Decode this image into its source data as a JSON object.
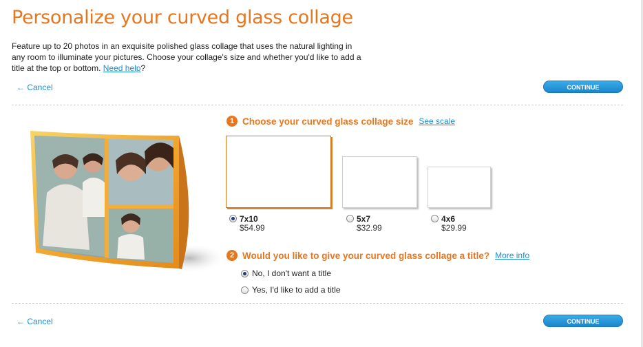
{
  "header": {
    "title": "Personalize your curved glass collage",
    "intro_text": "Feature up to 20 photos in an exquisite polished glass collage that uses the natural lighting in any room to illuminate your pictures. Choose your collage's size and whether you'd like to add a title at the top or bottom. ",
    "help_link": "Need help",
    "help_suffix": "?"
  },
  "nav": {
    "cancel_label": "← Cancel",
    "continue_label": "CONTINUE"
  },
  "step1": {
    "number": "1",
    "heading": "Choose your curved glass collage size",
    "link": "See scale",
    "options": [
      {
        "label": "7x10",
        "price": "$54.99",
        "selected": true
      },
      {
        "label": "5x7",
        "price": "$32.99",
        "selected": false
      },
      {
        "label": "4x6",
        "price": "$29.99",
        "selected": false
      }
    ]
  },
  "step2": {
    "number": "2",
    "heading": "Would you like to give your curved glass collage a title?",
    "link": "More info",
    "options": [
      {
        "label": "No, I don't want a title",
        "selected": true
      },
      {
        "label": "Yes, I'd like to add a title",
        "selected": false
      }
    ]
  },
  "colors": {
    "accent": "#e8761d",
    "link": "#1a8fcf",
    "button": "#1b86cc"
  }
}
